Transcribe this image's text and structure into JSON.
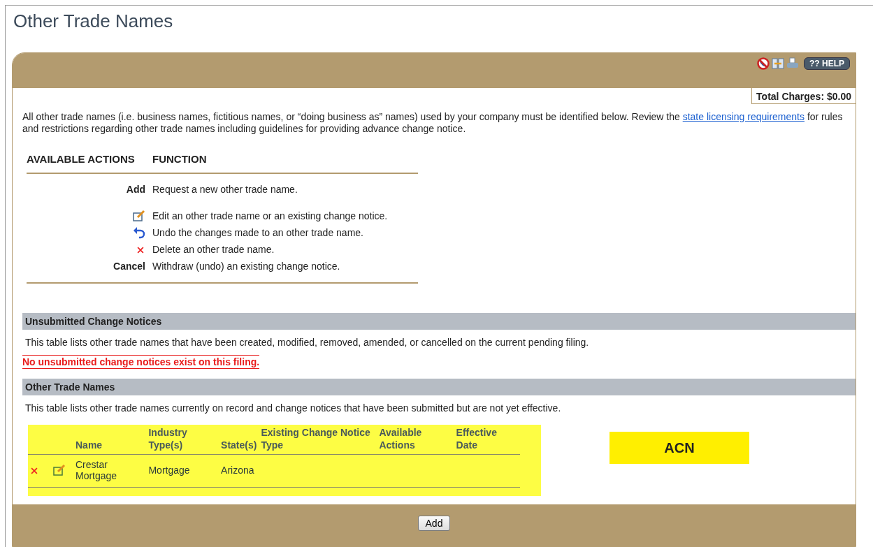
{
  "page_title": "Other Trade Names",
  "toolbar": {
    "help_label": "?? HELP"
  },
  "total_charges": "Total Charges: $0.00",
  "intro": {
    "before": "All other trade names (i.e. business names, fictitious names, or “doing business as” names) used by your company must be identified below. Review the ",
    "link": "state licensing requirements",
    "after": " for rules and restrictions regarding other trade names including guidelines for providing advance change notice."
  },
  "actions_table": {
    "columns": [
      "AVAILABLE ACTIONS",
      "FUNCTION"
    ],
    "rows": [
      {
        "kind": "label",
        "action": "Add",
        "function": "Request a new other trade name."
      },
      {
        "kind": "edit",
        "function": "Edit an other trade name or an existing change notice."
      },
      {
        "kind": "undo",
        "function": "Undo the changes made to an other trade name."
      },
      {
        "kind": "delete",
        "function": "Delete an other trade name."
      },
      {
        "kind": "label",
        "action": "Cancel",
        "function": "Withdraw (undo) an existing change notice."
      }
    ]
  },
  "unsubmitted": {
    "heading": "Unsubmitted Change Notices",
    "description": "This table lists other trade names that have been created, modified, removed, amended, or cancelled on the current pending filing.",
    "empty_message": "No unsubmitted change notices exist on this filing."
  },
  "trade_names": {
    "heading": "Other Trade Names",
    "description": "This table lists other trade names currently on record and change notices that have been submitted but are not yet effective.",
    "columns": [
      "Name",
      "Industry Type(s)",
      "State(s)",
      "Existing Change Notice Type",
      "Available Actions",
      "Effective Date"
    ],
    "rows": [
      {
        "cells": [
          "Crestar Mortgage",
          "Mortgage",
          "Arizona"
        ]
      }
    ]
  },
  "annotation": "ACN",
  "footer": {
    "button": "Add"
  }
}
